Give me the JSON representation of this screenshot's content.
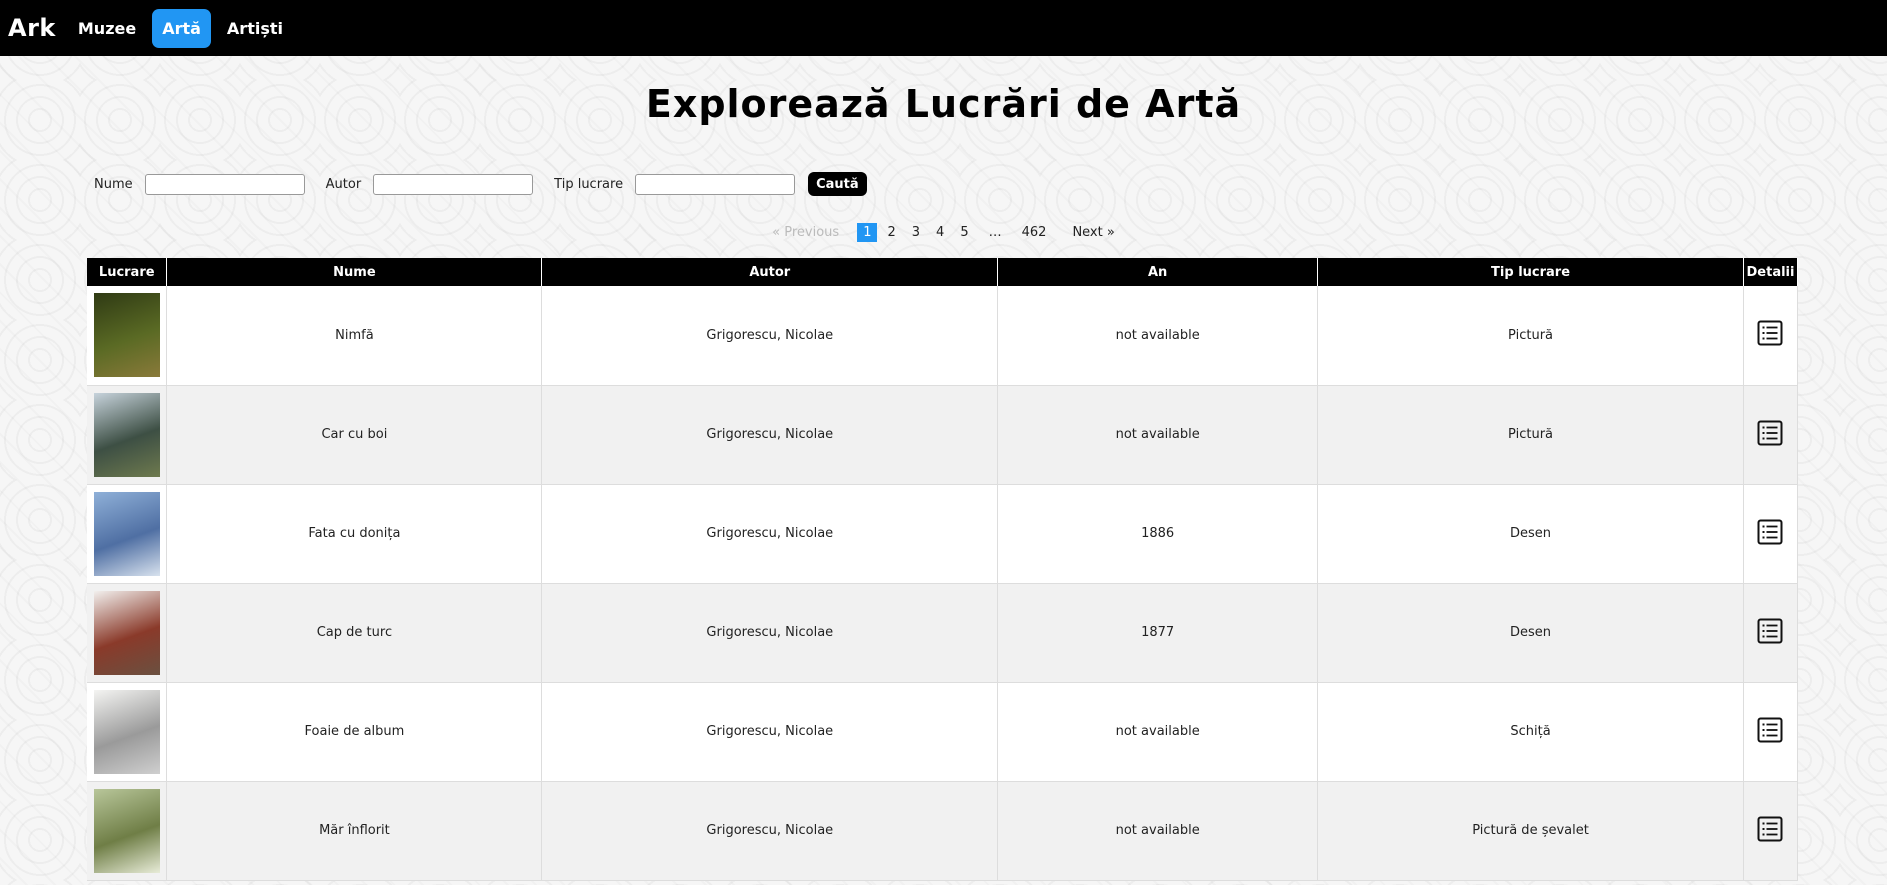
{
  "navbar": {
    "brand": "Ark",
    "links": [
      {
        "label": "Muzee"
      },
      {
        "label": "Artă"
      },
      {
        "label": "Artiști"
      }
    ]
  },
  "page_title": "Explorează Lucrări de Artă",
  "search": {
    "name_label": "Nume",
    "author_label": "Autor",
    "type_label": "Tip lucrare",
    "name_value": "",
    "author_value": "",
    "type_value": "",
    "button_label": "Caută"
  },
  "pagination": {
    "previous": "«  Previous",
    "pages": [
      "1",
      "2",
      "3",
      "4",
      "5"
    ],
    "ellipsis": "…",
    "last": "462",
    "next": "Next  »",
    "current": "1"
  },
  "table": {
    "headers": [
      "Lucrare",
      "Nume",
      "Autor",
      "An",
      "Tip lucrare",
      "Detalii"
    ],
    "rows": [
      {
        "name": "Nimfă",
        "author": "Grigorescu, Nicolae",
        "year": "not available",
        "type": "Pictură",
        "thumb_colors": [
          "#2f3a14",
          "#5a6a24",
          "#8a7a3a"
        ]
      },
      {
        "name": "Car cu boi",
        "author": "Grigorescu, Nicolae",
        "year": "not available",
        "type": "Pictură",
        "thumb_colors": [
          "#c7d3dc",
          "#3d4f44",
          "#6e7a4e"
        ]
      },
      {
        "name": "Fata cu donița",
        "author": "Grigorescu, Nicolae",
        "year": "1886",
        "type": "Desen",
        "thumb_colors": [
          "#8fb0d8",
          "#4f6fa3",
          "#d8e2ee"
        ]
      },
      {
        "name": "Cap de turc",
        "author": "Grigorescu, Nicolae",
        "year": "1877",
        "type": "Desen",
        "thumb_colors": [
          "#f2f0ee",
          "#8a3a2a",
          "#6a5040"
        ]
      },
      {
        "name": "Foaie de album",
        "author": "Grigorescu, Nicolae",
        "year": "not available",
        "type": "Schiță",
        "thumb_colors": [
          "#f4f4f2",
          "#9a9a9a",
          "#cfcfcf"
        ]
      },
      {
        "name": "Măr înflorit",
        "author": "Grigorescu, Nicolae",
        "year": "not available",
        "type": "Pictură de șevalet",
        "thumb_colors": [
          "#b8c69a",
          "#6f7e46",
          "#e8ecd8"
        ]
      }
    ]
  },
  "colors": {
    "navbar_bg": "#000000",
    "accent": "#2196f3",
    "header_bg": "#000000",
    "row_alt": "#f1f1f1"
  },
  "icons": {
    "details": "list-details-icon"
  }
}
